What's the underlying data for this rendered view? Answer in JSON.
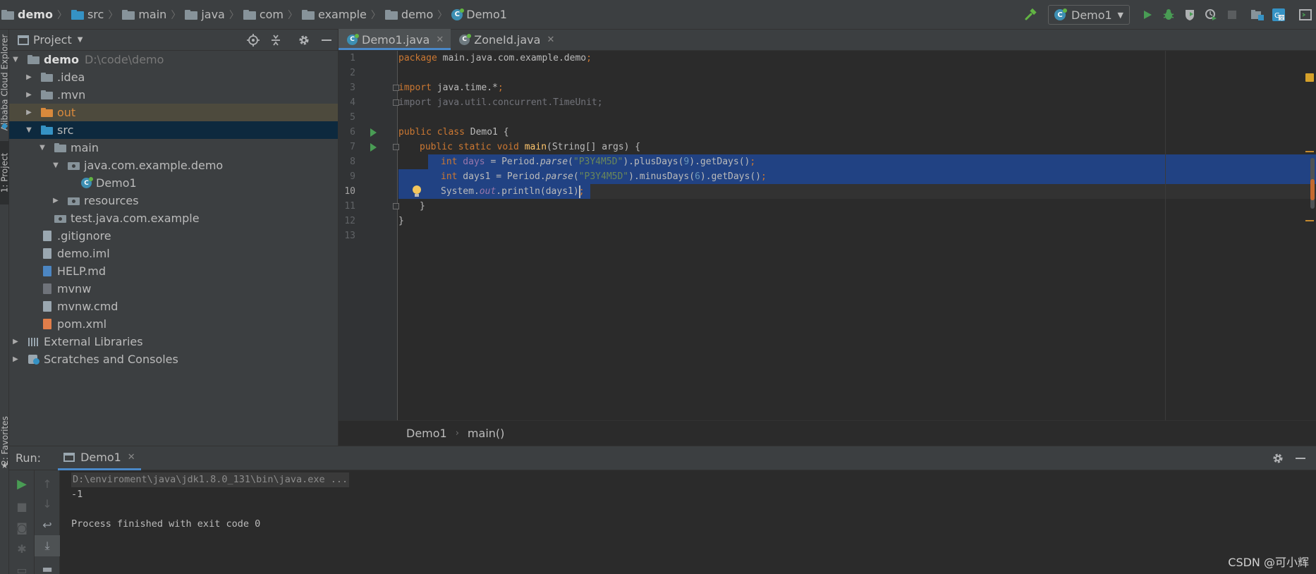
{
  "breadcrumbs": [
    {
      "label": "demo",
      "icon": "module-folder-icon",
      "bold": true
    },
    {
      "label": "src",
      "icon": "source-folder-icon"
    },
    {
      "label": "main",
      "icon": "folder-icon"
    },
    {
      "label": "java",
      "icon": "folder-icon"
    },
    {
      "label": "com",
      "icon": "folder-icon"
    },
    {
      "label": "example",
      "icon": "folder-icon"
    },
    {
      "label": "demo",
      "icon": "folder-icon"
    },
    {
      "label": "Demo1",
      "icon": "class-icon"
    }
  ],
  "toolbar": {
    "run_config": "Demo1",
    "icons": [
      "build-hammer-icon",
      "run-icon",
      "debug-icon",
      "coverage-icon",
      "profile-icon",
      "stop-icon",
      "project-structure-icon",
      "translate-icon",
      "terminal-icon"
    ]
  },
  "left_strip": {
    "cloud_tab": "Alibaba Cloud Explorer",
    "project_tab": "1: Project",
    "favorites_tab": "2: Favorites"
  },
  "project_panel": {
    "title": "Project",
    "tree": [
      {
        "label": "demo",
        "extra": "D:\\code\\demo",
        "indent": 0,
        "arrow": "down",
        "icon": "module-folder-icon",
        "bold": true
      },
      {
        "label": ".idea",
        "indent": 1,
        "arrow": "right",
        "icon": "folder-icon"
      },
      {
        "label": ".mvn",
        "indent": 1,
        "arrow": "right",
        "icon": "folder-icon"
      },
      {
        "label": "out",
        "indent": 1,
        "arrow": "right",
        "icon": "excluded-folder-icon",
        "state": "out"
      },
      {
        "label": "src",
        "indent": 1,
        "arrow": "down",
        "icon": "source-folder-icon",
        "state": "selected"
      },
      {
        "label": "main",
        "indent": 2,
        "arrow": "down",
        "icon": "folder-icon"
      },
      {
        "label": "java.com.example.demo",
        "indent": 3,
        "arrow": "down",
        "icon": "package-icon"
      },
      {
        "label": "Demo1",
        "indent": 4,
        "arrow": "",
        "icon": "class-icon"
      },
      {
        "label": "resources",
        "indent": 3,
        "arrow": "right",
        "icon": "package-icon"
      },
      {
        "label": "test.java.com.example",
        "indent": 2,
        "arrow": "",
        "icon": "package-icon"
      },
      {
        "label": ".gitignore",
        "indent": 1,
        "arrow": "",
        "icon": "file-icon"
      },
      {
        "label": "demo.iml",
        "indent": 1,
        "arrow": "",
        "icon": "file-icon"
      },
      {
        "label": "HELP.md",
        "indent": 1,
        "arrow": "",
        "icon": "markdown-file-icon"
      },
      {
        "label": "mvnw",
        "indent": 1,
        "arrow": "",
        "icon": "shell-file-icon"
      },
      {
        "label": "mvnw.cmd",
        "indent": 1,
        "arrow": "",
        "icon": "file-icon"
      },
      {
        "label": "pom.xml",
        "indent": 1,
        "arrow": "",
        "icon": "xml-file-icon"
      },
      {
        "label": "External Libraries",
        "indent": 0,
        "arrow": "right",
        "icon": "library-icon"
      },
      {
        "label": "Scratches and Consoles",
        "indent": 0,
        "arrow": "right",
        "icon": "scratch-icon"
      }
    ]
  },
  "editor": {
    "tabs": [
      {
        "label": "Demo1.java",
        "active": true
      },
      {
        "label": "ZoneId.java",
        "active": false
      }
    ],
    "line_numbers": [
      "1",
      "2",
      "3",
      "4",
      "5",
      "6",
      "7",
      "8",
      "9",
      "10",
      "11",
      "12",
      "13"
    ],
    "current_line": 10,
    "code": {
      "l1_kw": "package",
      "l1_rest": " main.java.com.example.demo",
      "l1_semi": ";",
      "l3_kw": "import",
      "l3_rest": " java.time.*",
      "l3_semi": ";",
      "l4_text": "import java.util.concurrent.TimeUnit;",
      "l6_kw": "public class",
      "l6_rest": " Demo1 {",
      "l7_kw": "public static void",
      "l7_fn": " main",
      "l7_rest": "(String[] args) {",
      "l8_kw": "int",
      "l8_var": " days",
      "l8_a": " = Period.",
      "l8_m": "parse",
      "l8_b": "(",
      "l8_str": "\"P3Y4M5D\"",
      "l8_c": ").plusDays(",
      "l8_num": "9",
      "l8_d": ").getDays()",
      "l8_semi": ";",
      "l9_kw": "int",
      "l9_a": " days1 = Period.",
      "l9_m": "parse",
      "l9_b": "(",
      "l9_str": "\"P3Y4M5D\"",
      "l9_c": ").minusDays(",
      "l9_num": "6",
      "l9_d": ").getDays()",
      "l9_semi": ";",
      "l10_a": "System.",
      "l10_field": "out",
      "l10_b": ".println(days1)",
      "l10_semi": ";",
      "l11": "}",
      "l12": "}"
    },
    "breadcrumb": [
      "Demo1",
      "main()"
    ]
  },
  "run_panel": {
    "label": "Run:",
    "tab": "Demo1",
    "output": [
      "D:\\enviroment\\java\\jdk1.8.0_131\\bin\\java.exe ...",
      "-1",
      "",
      "Process finished with exit code 0"
    ]
  },
  "watermark": "CSDN @可小辉"
}
